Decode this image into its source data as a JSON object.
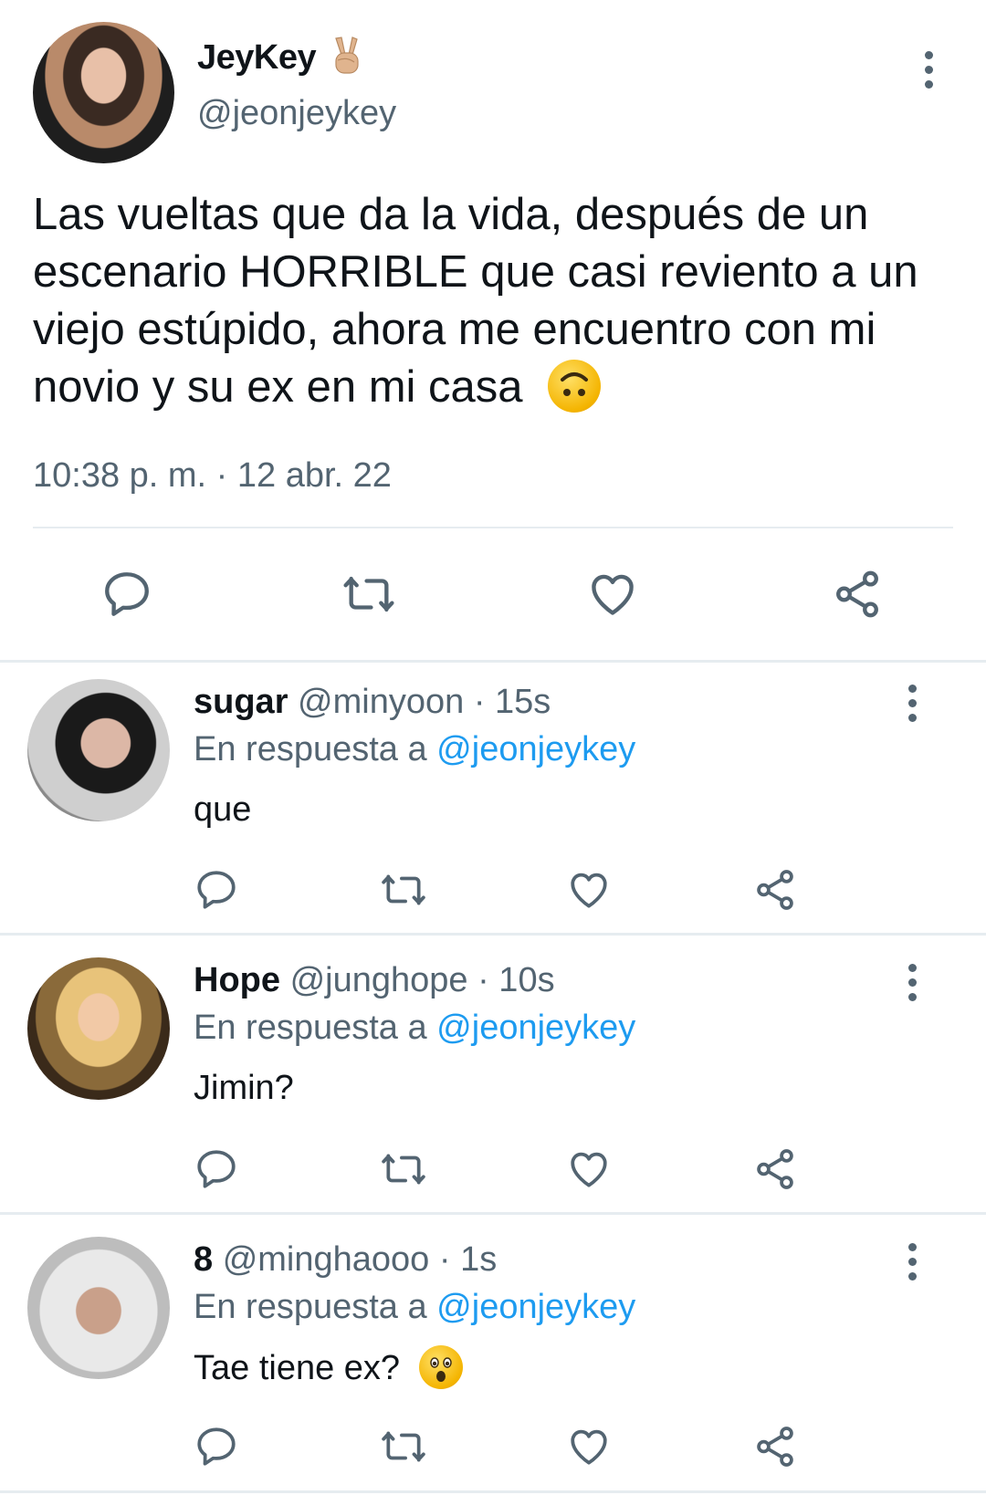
{
  "main_tweet": {
    "name": "JeyKey",
    "handle": "@jeonjeykey",
    "text": "Las vueltas que da la vida, después de un escenario HORRIBLE que casi reviento a un viejo estúpido, ahora me encuentro con mi novio y su ex en mi casa",
    "timestamp": "10:38 p. m. · 12 abr. 22"
  },
  "replies": [
    {
      "name": "sugar",
      "handle": "@minyoon",
      "time": "· 15s",
      "reply_prefix": "En respuesta a",
      "reply_to": "@jeonjeykey",
      "text": "que"
    },
    {
      "name": "Hope",
      "handle": "@junghope",
      "time": "· 10s",
      "reply_prefix": "En respuesta a",
      "reply_to": "@jeonjeykey",
      "text": "Jimin?"
    },
    {
      "name": "8",
      "handle": "@minghaooo",
      "time": "· 1s",
      "reply_prefix": "En respuesta a",
      "reply_to": "@jeonjeykey",
      "text": "Tae tiene ex?"
    }
  ],
  "colors": {
    "text": "#0f1419",
    "secondary": "#536471",
    "link": "#1d9bf0",
    "divider": "#e6ecf0"
  },
  "icons": {
    "name_emoji": "victory-hand-icon",
    "main_text_emoji": "upside-down-face-icon",
    "reply3_emoji": "astonished-face-icon",
    "actions": [
      "reply-icon",
      "retweet-icon",
      "like-icon",
      "share-icon"
    ],
    "menu": "more-options-icon"
  }
}
